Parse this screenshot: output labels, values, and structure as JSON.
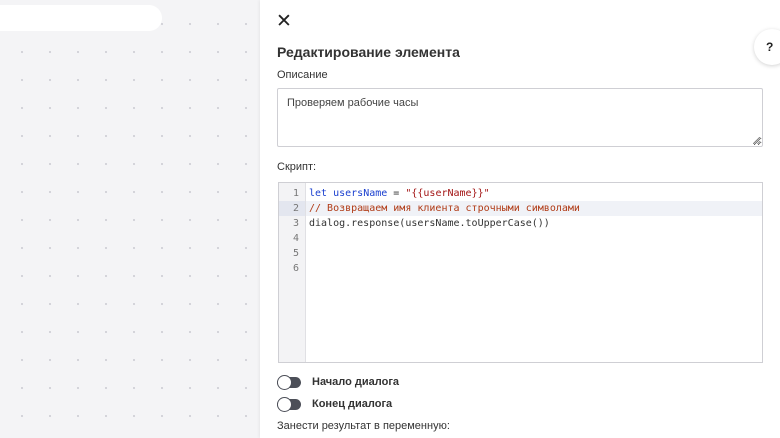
{
  "panel": {
    "close_icon": "close-icon",
    "close_glyph": "✕",
    "help_label": "?",
    "title": "Редактирование элемента",
    "description_label": "Описание",
    "description_value": "Проверяем рабочие часы",
    "script_label": "Скрипт:",
    "code_lines": [
      {
        "no": "1",
        "text": "let usersName = \"{{userName}}\""
      },
      {
        "no": "2",
        "text": "// Возвращаем имя клиента строчными символами"
      },
      {
        "no": "3",
        "text": "dialog.response(usersName.toUpperCase())"
      },
      {
        "no": "4",
        "text": ""
      },
      {
        "no": "5",
        "text": ""
      },
      {
        "no": "6",
        "text": ""
      }
    ],
    "toggles": [
      {
        "label": "Начало диалога",
        "on": false
      },
      {
        "label": "Конец диалога",
        "on": false
      }
    ],
    "result_label": "Занести результат в переменную:"
  },
  "colors": {
    "toggle_track": "#4c4f58",
    "keyword": "#1a3fcf",
    "string": "#a31515",
    "comment": "#b03a15"
  }
}
